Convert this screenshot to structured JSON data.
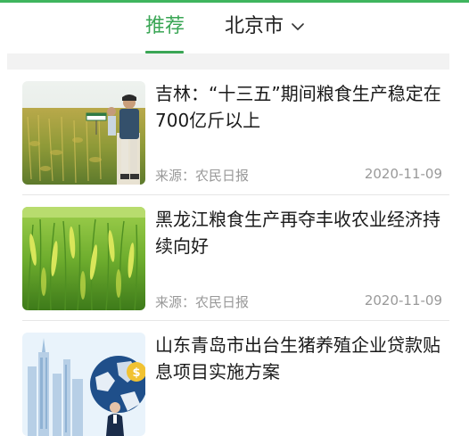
{
  "header": {
    "tab_recommend": "推荐",
    "city": "北京市",
    "accent_color": "#3aa655"
  },
  "articles": [
    {
      "title": "吉林：“十三五”期间粮食生产稳定在700亿斤以上",
      "source": "来源：农民日报",
      "date": "2020-11-09",
      "thumbnail": "rice-field-with-farmer"
    },
    {
      "title": "黑龙江粮食生产再夺丰收农业经济持续向好",
      "source": "来源：农民日报",
      "date": "2020-11-09",
      "thumbnail": "rice-closeup"
    },
    {
      "title": "山东青岛市出台生猪养殖企业贷款贴息项目实施方案",
      "source": "",
      "date": "",
      "thumbnail": "city-finance-illustration"
    }
  ]
}
